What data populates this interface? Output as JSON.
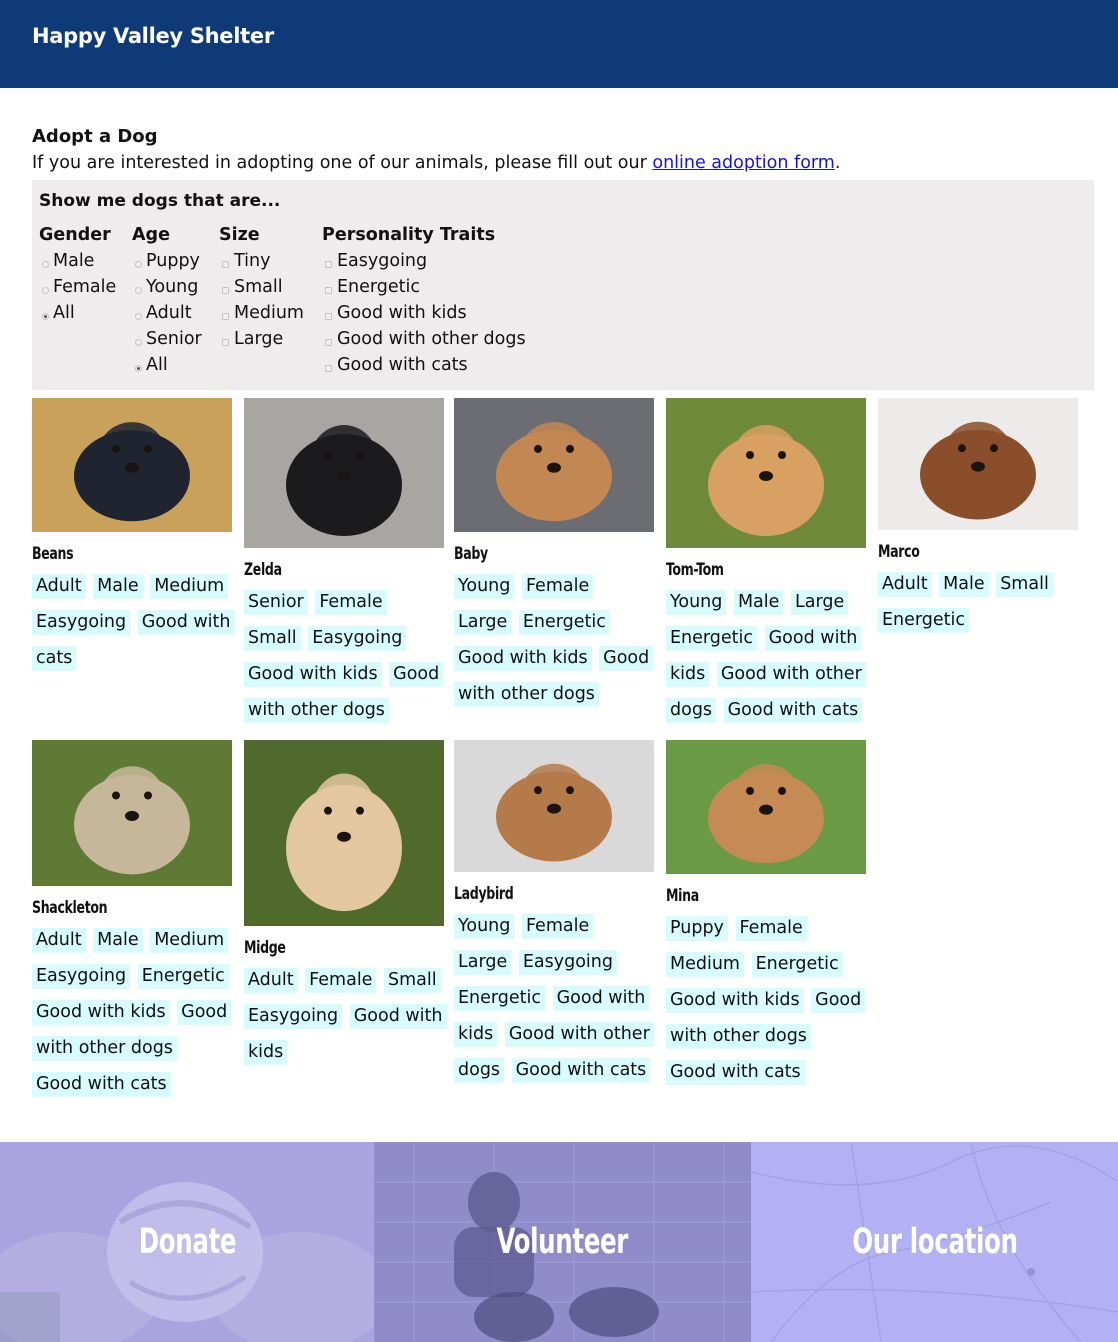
{
  "header": {
    "brand": "Happy Valley Shelter"
  },
  "intro": {
    "title": "Adopt a Dog",
    "text_before_link": "If you are interested in adopting one of our animals, please fill out our ",
    "link_text": "online adoption form",
    "text_after_link": "."
  },
  "filters": {
    "title": "Show me dogs that are...",
    "gender": {
      "heading": "Gender",
      "options": [
        "Male",
        "Female",
        "All"
      ],
      "selected": "All"
    },
    "age": {
      "heading": "Age",
      "options": [
        "Puppy",
        "Young",
        "Adult",
        "Senior",
        "All"
      ],
      "selected": "All"
    },
    "size": {
      "heading": "Size",
      "options": [
        "Tiny",
        "Small",
        "Medium",
        "Large"
      ]
    },
    "traits": {
      "heading": "Personality Traits",
      "options": [
        "Easygoing",
        "Energetic",
        "Good with kids",
        "Good with other dogs",
        "Good with cats"
      ]
    }
  },
  "dogs": [
    {
      "name": "Beans",
      "tags": [
        "Adult",
        "Male",
        "Medium",
        "Easygoing",
        "Good with cats"
      ],
      "colors": [
        "#c9a15b",
        "#1f2430"
      ]
    },
    {
      "name": "Zelda",
      "tags": [
        "Senior",
        "Female",
        "Small",
        "Easygoing",
        "Good with kids",
        "Good with other dogs"
      ],
      "colors": [
        "#a7a6a3",
        "#1b1b1e"
      ]
    },
    {
      "name": "Baby",
      "tags": [
        "Young",
        "Female",
        "Large",
        "Energetic",
        "Good with kids",
        "Good with other dogs"
      ],
      "colors": [
        "#6b6d72",
        "#c28752"
      ]
    },
    {
      "name": "Tom-Tom",
      "tags": [
        "Young",
        "Male",
        "Large",
        "Energetic",
        "Good with kids",
        "Good with other dogs",
        "Good with cats"
      ],
      "colors": [
        "#6e8a3a",
        "#d8a062"
      ]
    },
    {
      "name": "Marco",
      "tags": [
        "Adult",
        "Male",
        "Small",
        "Energetic"
      ],
      "colors": [
        "#ecebea",
        "#8a4f2a"
      ]
    },
    {
      "name": "Shackleton",
      "tags": [
        "Adult",
        "Male",
        "Medium",
        "Easygoing",
        "Energetic",
        "Good with kids",
        "Good with other dogs",
        "Good with cats"
      ],
      "colors": [
        "#5f7a35",
        "#c7b79a"
      ]
    },
    {
      "name": "Midge",
      "tags": [
        "Adult",
        "Female",
        "Small",
        "Easygoing",
        "Good with kids"
      ],
      "colors": [
        "#4f6a2a",
        "#e2c7a0"
      ]
    },
    {
      "name": "Ladybird",
      "tags": [
        "Young",
        "Female",
        "Large",
        "Easygoing",
        "Energetic",
        "Good with kids",
        "Good with other dogs",
        "Good with cats"
      ],
      "colors": [
        "#d9d9d9",
        "#b57a4a"
      ]
    },
    {
      "name": "Mina",
      "tags": [
        "Puppy",
        "Female",
        "Medium",
        "Energetic",
        "Good with kids",
        "Good with other dogs",
        "Good with cats"
      ],
      "colors": [
        "#6a9a45",
        "#c58a55"
      ]
    }
  ],
  "bottom_links": [
    {
      "label": "Donate"
    },
    {
      "label": "Volunteer"
    },
    {
      "label": "Our location"
    }
  ]
}
